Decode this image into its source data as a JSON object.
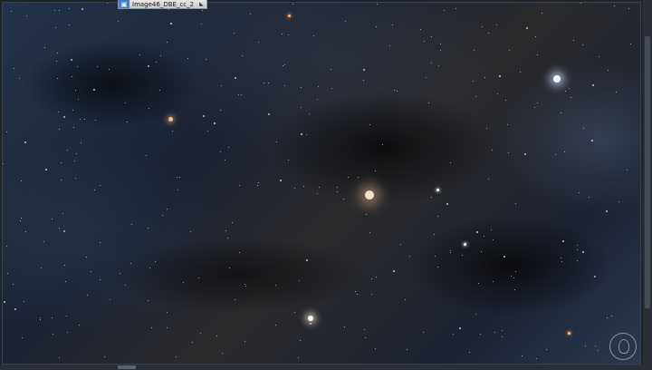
{
  "window": {
    "title": "Image46_DBE_cc_2",
    "icon": "image-window-icon",
    "collapse_glyph": "◣"
  },
  "colors": {
    "tab_icon": "#3e7fd0",
    "workspace": "#1f232a"
  }
}
